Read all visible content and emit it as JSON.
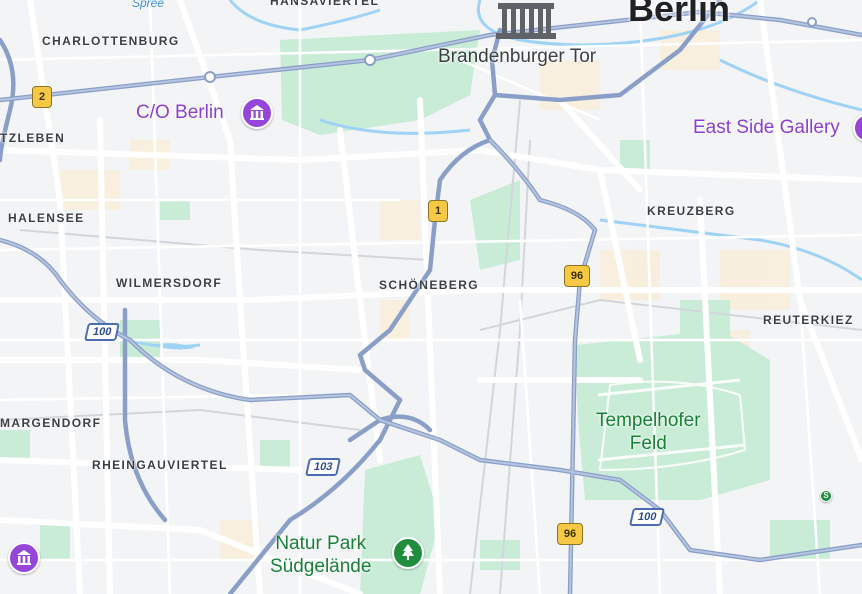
{
  "city": "Berlin",
  "districts": {
    "charlottenburg": "CHARLOTTENBURG",
    "witzleben": "TZLEBEN",
    "halensee": "HALENSEE",
    "wilmersdorf": "WILMERSDORF",
    "schoeneberg": "SCHÖNEBERG",
    "kreuzberg": "KREUZBERG",
    "reuterkiez": "REUTERKIEZ",
    "schmargendorf": "MARGENDORF",
    "rheingauviertel": "RHEINGAUVIERTEL",
    "tiergarten_top": "HANSAVIERTEL"
  },
  "water": {
    "spree": "Spree"
  },
  "pois": {
    "brandenburger_tor": "Brandenburger Tor",
    "co_berlin": "C/O Berlin",
    "east_side_gallery": "East Side Gallery",
    "tempelhofer_feld_line1": "Tempelhofer",
    "tempelhofer_feld_line2": "Feld",
    "natur_park_line1": "Natur Park",
    "natur_park_line2": "Südgelände"
  },
  "shields": {
    "a100_west": "100",
    "a103": "103",
    "a100_south": "100",
    "b96_north": "96",
    "b96_south": "96",
    "b1": "1",
    "b2": "2",
    "sbahn": "S"
  },
  "colors": {
    "background": "#f3f4f5",
    "park": "#c4ecd3",
    "highway": "#8a9fc8",
    "road": "#ffffff",
    "poi_purple": "#8a3fd1",
    "poi_green": "#188038",
    "federal_shield": "#f7c844"
  }
}
